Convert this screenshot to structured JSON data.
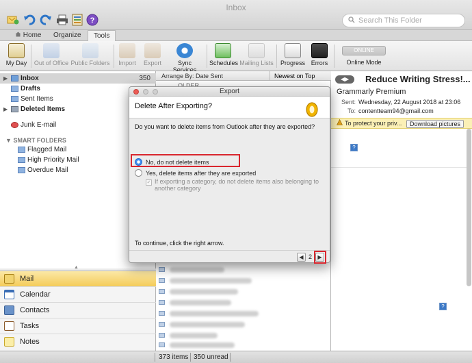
{
  "window": {
    "title": "Inbox"
  },
  "search": {
    "placeholder": "Search This Folder"
  },
  "ribbon_tabs": [
    {
      "label": "Home"
    },
    {
      "label": "Organize"
    },
    {
      "label": "Tools"
    }
  ],
  "ribbon": {
    "my_day": "My Day",
    "out_of_office": "Out of Office",
    "public_folders": "Public Folders",
    "import": "Import",
    "export": "Export",
    "sync_services": "Sync Services",
    "schedules": "Schedules",
    "mailing_lists": "Mailing Lists",
    "progress": "Progress",
    "errors": "Errors",
    "online_pill": "ONLINE",
    "online_mode": "Online Mode"
  },
  "folders": {
    "inbox": {
      "label": "Inbox",
      "count": "350"
    },
    "drafts": "Drafts",
    "sent": "Sent Items",
    "deleted": "Deleted Items",
    "junk": "Junk E-mail",
    "smart_folders": "SMART FOLDERS",
    "flagged": "Flagged Mail",
    "high_priority": "High Priority Mail",
    "overdue": "Overdue Mail"
  },
  "nav": {
    "mail": "Mail",
    "calendar": "Calendar",
    "contacts": "Contacts",
    "tasks": "Tasks",
    "notes": "Notes"
  },
  "list": {
    "arrange_by": "Arrange By: Date Sent",
    "sort": "Newest on Top",
    "older": "OLDER"
  },
  "reading": {
    "subject": "Reduce Writing Stress!...",
    "sender": "Grammarly Premium",
    "sent_label": "Sent:",
    "sent_value": "Wednesday, 22 August 2018 at 23:06",
    "to_label": "To:",
    "to_value": "contentteam94@gmail.com",
    "protect_text": "To protect your priv...",
    "download_button": "Download pictures"
  },
  "status": {
    "items": "373 items",
    "unread": "350 unread"
  },
  "dialog": {
    "title": "Export",
    "heading": "Delete After Exporting?",
    "question": "Do you want to delete items from Outlook after they are exported?",
    "option_no": "No, do not delete items",
    "option_yes": "Yes, delete items after they are exported",
    "checkbox_label": "If exporting a category, do not delete items also belonging to another category",
    "footer_text": "To continue, click the right arrow.",
    "page_number": "2"
  },
  "colors": {
    "accent_blue": "#3f8ef0",
    "highlight_red": "#d9262e",
    "nav_active": "#f4cc5a",
    "warning_bar": "#fbf0b6"
  }
}
